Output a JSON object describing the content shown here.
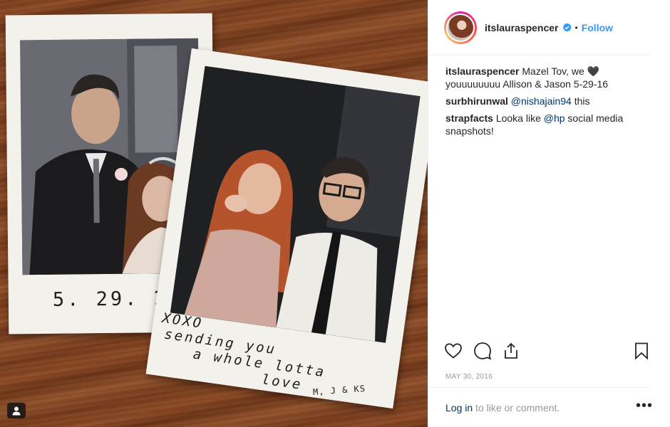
{
  "post": {
    "username": "itslauraspencer",
    "verified": true,
    "follow_label": "Follow",
    "separator": "•",
    "date": "MAY 30, 2016"
  },
  "photo": {
    "left_date_text": "5. 29. 2016",
    "right_note_lines": [
      "XOXO",
      "sending you",
      "a whole lotta",
      "love"
    ],
    "right_signature": "M, J & KS"
  },
  "comments": [
    {
      "user": "itslauraspencer",
      "text": "Mazel Tov, we 🖤 youuuuuuuu Allison & Jason 5-29-16"
    },
    {
      "user": "surbhirunwal",
      "mention": "@nishajain94",
      "text": " this"
    },
    {
      "user": "strapfacts",
      "text_before": "Looka like ",
      "mention": "@hp",
      "text_after": " social media snapshots!"
    }
  ],
  "footer": {
    "login_link": "Log in",
    "login_rest": " to like or comment.",
    "more_label": "•••"
  },
  "icons": {
    "like": "heart-icon",
    "comment": "comment-bubble-icon",
    "share": "share-icon",
    "save": "bookmark-icon",
    "verified": "verified-badge-icon",
    "more": "more-options-icon",
    "profile": "tagged-user-icon"
  },
  "colors": {
    "accent": "#3897f0",
    "link": "#003569",
    "muted": "#999999"
  }
}
